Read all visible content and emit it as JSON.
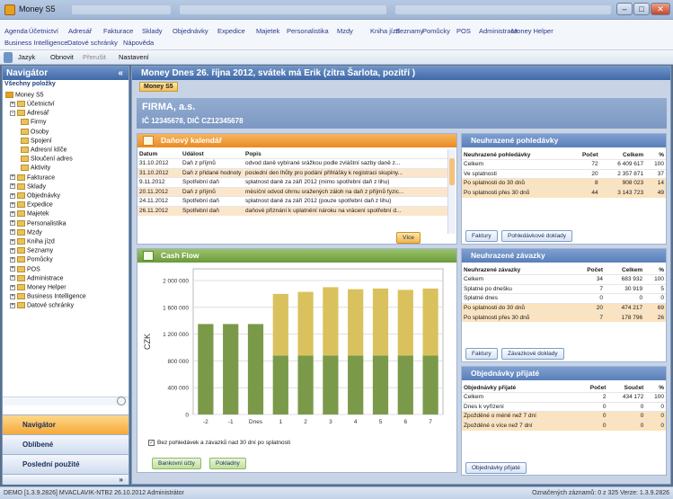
{
  "window": {
    "title": "Money S5",
    "min": "–",
    "max": "□",
    "close": "✕"
  },
  "menu": [
    "Agenda",
    "Účetnictví",
    "Adresář",
    "Fakturace",
    "Sklady",
    "Objednávky",
    "Expedice",
    "Majetek",
    "Personalistika",
    "Mzdy",
    "Kniha jízd",
    "Seznamy",
    "Pomůcky",
    "POS",
    "Administrace",
    "Money Helper",
    "Business Intelligence",
    "Datové schránky",
    "Nápověda"
  ],
  "toolbar": {
    "jazyk": "Jazyk",
    "obnovit": "Obnovit",
    "prerusit": "Přerušit",
    "nastaveni": "Nastavení"
  },
  "navigator": {
    "title": "Navigátor",
    "collapse": "«",
    "all": "Všechny položky",
    "root": "Money S5",
    "tree": [
      "Účetnictví",
      "Adresář",
      "Firmy",
      "Osoby",
      "Spojení",
      "Adresní klíče",
      "Sloučení adres",
      "Aktivity",
      "Fakturace",
      "Sklady",
      "Objednávky",
      "Expedice",
      "Majetek",
      "Personalistika",
      "Mzdy",
      "Kniha jízd",
      "Seznamy",
      "Pomůcky",
      "POS",
      "Administrace",
      "Money Helper",
      "Business Intelligence",
      "Datové schránky"
    ],
    "buttons": [
      "Navigátor",
      "Oblíbené",
      "Poslední použité"
    ],
    "more": "»"
  },
  "main": {
    "title": "Money Dnes 26. října 2012, svátek má Erik (zítra Šarlota, pozítří )",
    "tab": "Money S5",
    "firm": {
      "name": "FIRMA, a.s.",
      "ico": "IČ 12345678, DIČ CZ12345678"
    }
  },
  "tax": {
    "title": "Daňový kalendář",
    "cols": [
      "Datum",
      "Událost",
      "Popis"
    ],
    "more": "Více",
    "rows": [
      [
        "31.10.2012",
        "Daň z příjmů",
        "odvod daně vybírané srážkou podle zvláštní sazby daně z..."
      ],
      [
        "31.10.2012",
        "Daň z přidané hodnoty",
        "poslední den lhůty pro podání přihlášky k registraci skupiny..."
      ],
      [
        "9.11.2012",
        "Spotřební daň",
        "splatnost daně za září 2012 (mimo spotřební daň z lihu)"
      ],
      [
        "20.11.2012",
        "Daň z příjmů",
        "měsíční odvod úhrnu sražených záloh na daň z příjmů fyzic..."
      ],
      [
        "24.11.2012",
        "Spotřební daň",
        "splatnost daně za září 2012 (pouze spotřební daň z lihu)"
      ],
      [
        "26.11.2012",
        "Spotřební daň",
        "daňové přiznání k uplatnění nároku na vrácení spotřební d..."
      ]
    ]
  },
  "cashflow": {
    "title": "Cash Flow",
    "checkbox": "Bez pohledávek a závazků nad 30 dní po splatnosti",
    "buttons": [
      "Bankovní účty",
      "Pokladny"
    ]
  },
  "chart_data": {
    "type": "bar",
    "ylabel": "CZK",
    "ylim": [
      0,
      2000000
    ],
    "yticks": [
      "2 000 000",
      "1 600 000",
      "1 200 000",
      "800 000",
      "400 000",
      "0"
    ],
    "categories": [
      "-2",
      "-1",
      "Dnes",
      "1",
      "2",
      "3",
      "4",
      "5",
      "6",
      "7"
    ],
    "series": [
      {
        "values": [
          1350000,
          1350000,
          1350000,
          880000,
          880000,
          880000,
          880000,
          880000,
          880000,
          880000
        ]
      },
      {
        "values": [
          0,
          0,
          0,
          920000,
          950000,
          1020000,
          990000,
          1000000,
          980000,
          1000000
        ]
      }
    ],
    "colors": [
      "#7a9a4a",
      "#d9c25e"
    ]
  },
  "receivables": {
    "title": "Neuhrazené pohledávky",
    "cols": [
      "Neuhrazené pohledávky",
      "Počet",
      "Celkem",
      "%"
    ],
    "rows": [
      [
        "Celkem",
        "72",
        "6 409 617",
        "100"
      ],
      [
        "Ve splatnosti",
        "20",
        "2 357 871",
        "37"
      ],
      [
        "Po splatnosti do 30 dnů",
        "8",
        "908 023",
        "14"
      ],
      [
        "Po splatnosti přes 30 dnů",
        "44",
        "3 143 723",
        "49"
      ]
    ],
    "buttons": [
      "Faktury",
      "Pohledávkové doklady"
    ]
  },
  "payables": {
    "title": "Neuhrazené závazky",
    "cols": [
      "Neuhrazené závazky",
      "Počet",
      "Celkem",
      "%"
    ],
    "rows": [
      [
        "Celkem",
        "34",
        "683 932",
        "100"
      ],
      [
        "Splatné po dnešku",
        "7",
        "30 919",
        "5"
      ],
      [
        "Splatné dnes",
        "0",
        "0",
        "0"
      ],
      [
        "Po splatnosti do 30 dnů",
        "20",
        "474 217",
        "69"
      ],
      [
        "Po splatnosti přes 30 dnů",
        "7",
        "178 796",
        "26"
      ]
    ],
    "buttons": [
      "Faktury",
      "Závazkové doklady"
    ]
  },
  "orders": {
    "title": "Objednávky přijaté",
    "cols": [
      "Objednávky přijaté",
      "Počet",
      "Součet",
      "%"
    ],
    "rows": [
      [
        "Celkem",
        "2",
        "434 172",
        "100"
      ],
      [
        "Dnes k vyřízení",
        "0",
        "0",
        "0"
      ],
      [
        "Zpožděné o méně než 7 dní",
        "0",
        "0",
        "0"
      ],
      [
        "Zpožděné o více než 7 dní",
        "0",
        "0",
        "0"
      ]
    ],
    "buttons": [
      "Objednávky přijaté"
    ]
  },
  "status": {
    "left": "DEMO [1.3.9.2826]  MVACLAVIK-NTB2  26.10.2012  Administrátor",
    "right": "Označených záznamů: 0 z 325  Verze: 1.3.9.2826"
  }
}
